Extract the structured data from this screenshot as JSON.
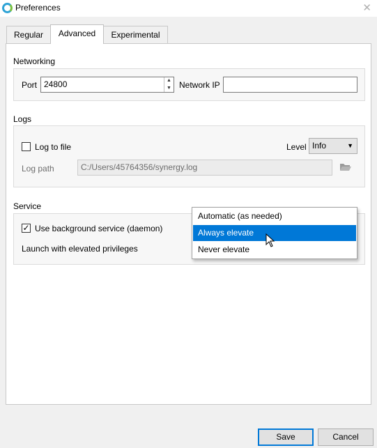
{
  "window": {
    "title": "Preferences",
    "close_glyph": "✕"
  },
  "tabs": [
    {
      "label": "Regular",
      "active": false
    },
    {
      "label": "Advanced",
      "active": true
    },
    {
      "label": "Experimental",
      "active": false
    }
  ],
  "networking": {
    "heading": "Networking",
    "port_label": "Port",
    "port_value": "24800",
    "network_ip_label": "Network IP",
    "network_ip_value": ""
  },
  "logs": {
    "heading": "Logs",
    "log_to_file_label": "Log to file",
    "log_to_file_checked": false,
    "level_label": "Level",
    "level_value": "Info",
    "log_path_label": "Log path",
    "log_path_value": "C:/Users/45764356/synergy.log"
  },
  "service": {
    "heading": "Service",
    "daemon_label": "Use background service (daemon)",
    "daemon_checked": true,
    "elevated_label": "Launch with elevated privileges",
    "elevation_options": [
      "Automatic (as needed)",
      "Always elevate",
      "Never elevate"
    ],
    "highlighted_option": "Always elevate"
  },
  "buttons": {
    "save": "Save",
    "cancel": "Cancel"
  },
  "colors": {
    "selection": "#0078d7",
    "panel": "#ffffff",
    "window": "#f0f0f0"
  }
}
